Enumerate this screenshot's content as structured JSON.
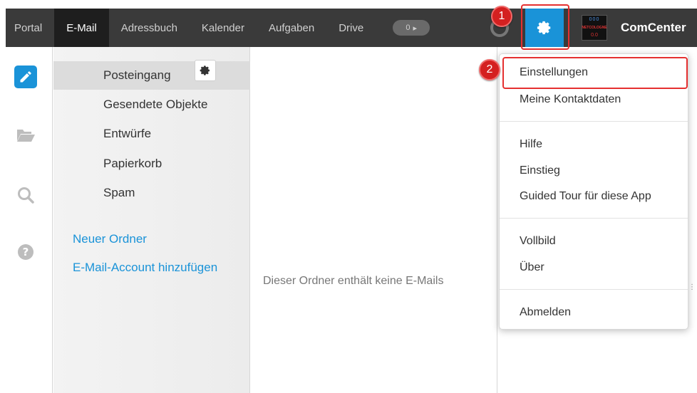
{
  "topbar": {
    "tabs": [
      {
        "label": "Portal"
      },
      {
        "label": "E-Mail"
      },
      {
        "label": "Adressbuch"
      },
      {
        "label": "Kalender"
      },
      {
        "label": "Aufgaben"
      },
      {
        "label": "Drive"
      }
    ],
    "counter_value": "0",
    "brand_name": "ComCenter",
    "brand_logo_top": "000",
    "brand_logo_mid": "NETCOLOGNE",
    "brand_logo_bottom": "0.0"
  },
  "annotations": {
    "step1": "1",
    "step2": "2"
  },
  "folders": {
    "items": [
      {
        "label": "Posteingang"
      },
      {
        "label": "Gesendete Objekte"
      },
      {
        "label": "Entwürfe"
      },
      {
        "label": "Papierkorb"
      },
      {
        "label": "Spam"
      }
    ],
    "new_folder": "Neuer Ordner",
    "add_account": "E-Mail-Account hinzufügen"
  },
  "maillist": {
    "empty_message": "Dieser Ordner enthält keine E-Mails"
  },
  "menu": {
    "settings": "Einstellungen",
    "contact_data": "Meine Kontaktdaten",
    "help": "Hilfe",
    "getting_started": "Einstieg",
    "guided_tour": "Guided Tour für diese App",
    "fullscreen": "Vollbild",
    "about": "Über",
    "logout": "Abmelden"
  },
  "colors": {
    "accent": "#1a93d8",
    "topbar": "#3a3a3a",
    "highlight": "#e53030"
  }
}
